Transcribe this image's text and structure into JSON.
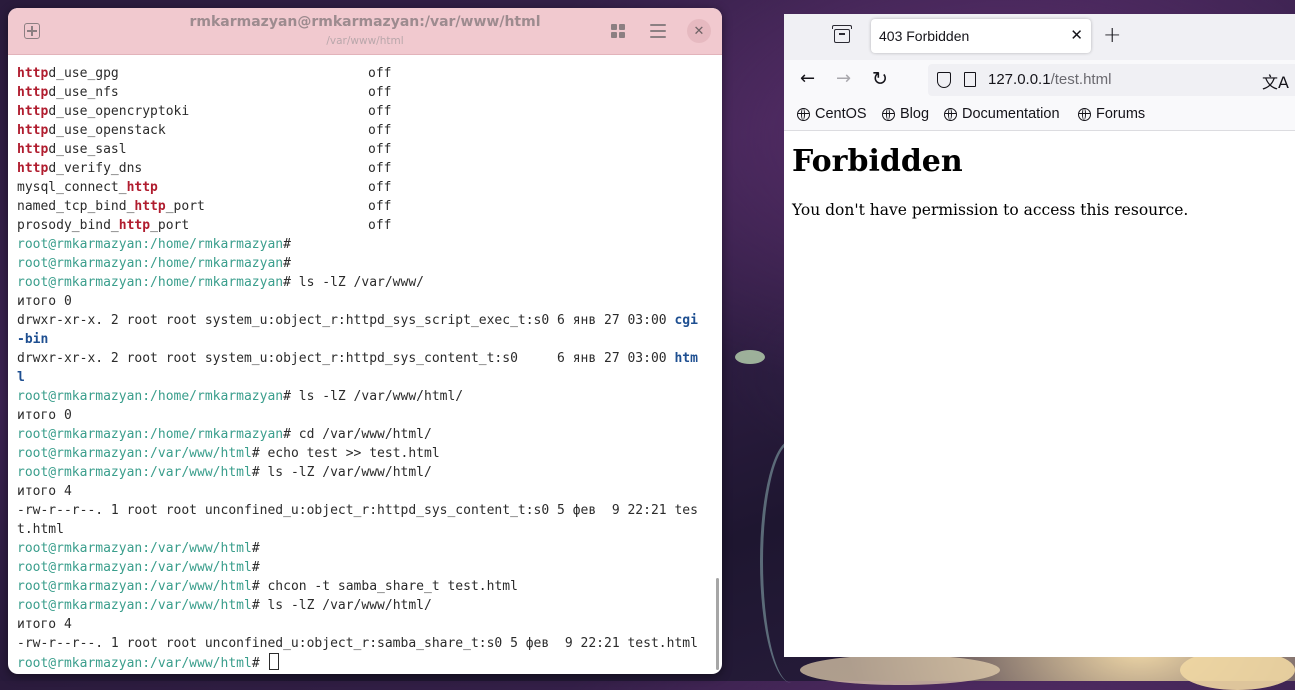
{
  "terminal": {
    "title": "rmkarmazyan@rmkarmazyan:/var/www/html",
    "subtitle": "/var/www/html",
    "lines": [
      {
        "parts": [
          [
            "hl",
            "http"
          ],
          [
            "",
            "d_use_gpg"
          ]
        ],
        "col2": "off"
      },
      {
        "parts": [
          [
            "hl",
            "http"
          ],
          [
            "",
            "d_use_nfs"
          ]
        ],
        "col2": "off"
      },
      {
        "parts": [
          [
            "hl",
            "http"
          ],
          [
            "",
            "d_use_opencryptoki"
          ]
        ],
        "col2": "off"
      },
      {
        "parts": [
          [
            "hl",
            "http"
          ],
          [
            "",
            "d_use_openstack"
          ]
        ],
        "col2": "off"
      },
      {
        "parts": [
          [
            "hl",
            "http"
          ],
          [
            "",
            "d_use_sasl"
          ]
        ],
        "col2": "off"
      },
      {
        "parts": [
          [
            "hl",
            "http"
          ],
          [
            "",
            "d_verify_dns"
          ]
        ],
        "col2": "off"
      },
      {
        "parts": [
          [
            "",
            "mysql_connect_"
          ],
          [
            "hl",
            "http"
          ]
        ],
        "col2": "off"
      },
      {
        "parts": [
          [
            "",
            "named_tcp_bind_"
          ],
          [
            "hl",
            "http"
          ],
          [
            "",
            "_port"
          ]
        ],
        "col2": "off"
      },
      {
        "parts": [
          [
            "",
            "prosody_bind_"
          ],
          [
            "hl",
            "http"
          ],
          [
            "",
            "_port"
          ]
        ],
        "col2": "off"
      },
      {
        "parts": [
          [
            "prompt",
            "root@rmkarmazyan:/home/rmkarmazyan"
          ],
          [
            "",
            "#"
          ]
        ]
      },
      {
        "parts": [
          [
            "prompt",
            "root@rmkarmazyan:/home/rmkarmazyan"
          ],
          [
            "",
            "#"
          ]
        ]
      },
      {
        "parts": [
          [
            "prompt",
            "root@rmkarmazyan:/home/rmkarmazyan"
          ],
          [
            "",
            "# ls -lZ /var/www/"
          ]
        ]
      },
      {
        "parts": [
          [
            "",
            "итого 0"
          ]
        ]
      },
      {
        "parts": [
          [
            "",
            "drwxr-xr-x. 2 root root system_u:object_r:httpd_sys_script_exec_t:s0 6 янв 27 03:00 "
          ],
          [
            "dir",
            "cgi"
          ]
        ]
      },
      {
        "parts": [
          [
            "dir",
            "-bin"
          ]
        ]
      },
      {
        "parts": [
          [
            "",
            "drwxr-xr-x. 2 root root system_u:object_r:httpd_sys_content_t:s0     6 янв 27 03:00 "
          ],
          [
            "dir",
            "htm"
          ]
        ]
      },
      {
        "parts": [
          [
            "dir",
            "l"
          ]
        ]
      },
      {
        "parts": [
          [
            "prompt",
            "root@rmkarmazyan:/home/rmkarmazyan"
          ],
          [
            "",
            "# ls -lZ /var/www/html/"
          ]
        ]
      },
      {
        "parts": [
          [
            "",
            "итого 0"
          ]
        ]
      },
      {
        "parts": [
          [
            "prompt",
            "root@rmkarmazyan:/home/rmkarmazyan"
          ],
          [
            "",
            "# cd /var/www/html/"
          ]
        ]
      },
      {
        "parts": [
          [
            "prompt",
            "root@rmkarmazyan:/var/www/html"
          ],
          [
            "",
            "# echo test >> test.html"
          ]
        ]
      },
      {
        "parts": [
          [
            "prompt",
            "root@rmkarmazyan:/var/www/html"
          ],
          [
            "",
            "# ls -lZ /var/www/html/"
          ]
        ]
      },
      {
        "parts": [
          [
            "",
            "итого 4"
          ]
        ]
      },
      {
        "parts": [
          [
            "",
            "-rw-r--r--. 1 root root unconfined_u:object_r:httpd_sys_content_t:s0 5 фев  9 22:21 tes"
          ]
        ]
      },
      {
        "parts": [
          [
            "",
            "t.html"
          ]
        ]
      },
      {
        "parts": [
          [
            "prompt",
            "root@rmkarmazyan:/var/www/html"
          ],
          [
            "",
            "#"
          ]
        ]
      },
      {
        "parts": [
          [
            "prompt",
            "root@rmkarmazyan:/var/www/html"
          ],
          [
            "",
            "#"
          ]
        ]
      },
      {
        "parts": [
          [
            "prompt",
            "root@rmkarmazyan:/var/www/html"
          ],
          [
            "",
            "# chcon -t samba_share_t test.html"
          ]
        ]
      },
      {
        "parts": [
          [
            "prompt",
            "root@rmkarmazyan:/var/www/html"
          ],
          [
            "",
            "# ls -lZ /var/www/html/"
          ]
        ]
      },
      {
        "parts": [
          [
            "",
            "итого 4"
          ]
        ]
      },
      {
        "parts": [
          [
            "",
            "-rw-r--r--. 1 root root unconfined_u:object_r:samba_share_t:s0 5 фев  9 22:21 test.html"
          ]
        ]
      },
      {
        "parts": [
          [
            "prompt",
            "root@rmkarmazyan:/var/www/html"
          ],
          [
            "",
            "# "
          ]
        ],
        "cursor": true
      }
    ]
  },
  "browser": {
    "tab_title": "403 Forbidden",
    "url_host": "127.0.0.1",
    "url_path": "/test.html",
    "bookmarks": [
      "CentOS",
      "Blog",
      "Documentation",
      "Forums"
    ],
    "heading": "Forbidden",
    "message": "You don't have permission to access this resource."
  },
  "colors": {
    "terminal_header": "#f1c9cf",
    "prompt": "#3a9e8c",
    "highlight": "#b01c2e",
    "directory": "#1e4f91"
  }
}
